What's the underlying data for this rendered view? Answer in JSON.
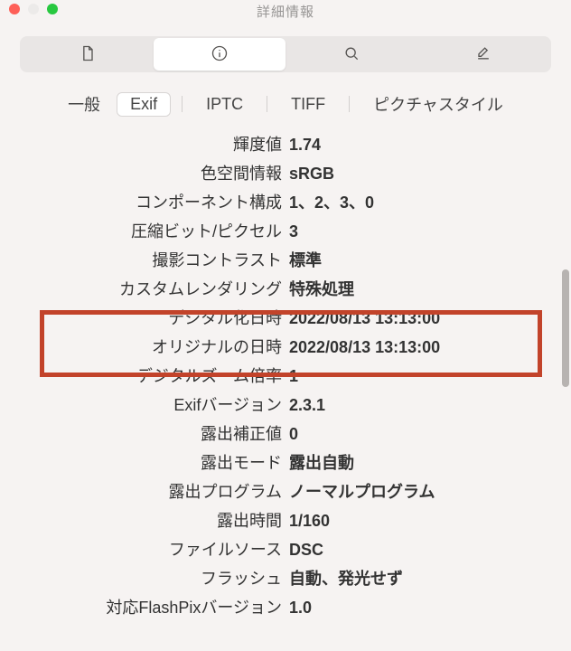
{
  "window": {
    "title": "詳細情報"
  },
  "toolbar": {
    "items": [
      {
        "name": "file-icon"
      },
      {
        "name": "info-icon",
        "selected": true
      },
      {
        "name": "search-icon"
      },
      {
        "name": "edit-icon"
      }
    ]
  },
  "tabs": {
    "items": [
      {
        "id": "general",
        "label": "一般"
      },
      {
        "id": "exif",
        "label": "Exif",
        "selected": true
      },
      {
        "id": "iptc",
        "label": "IPTC"
      },
      {
        "id": "tiff",
        "label": "TIFF"
      },
      {
        "id": "picturestyle",
        "label": "ピクチャスタイル"
      }
    ]
  },
  "exif": {
    "rows": [
      {
        "label": "輝度値",
        "value": "1.74"
      },
      {
        "label": "色空間情報",
        "value": "sRGB"
      },
      {
        "label": "コンポーネント構成",
        "value": "1、2、3、0"
      },
      {
        "label": "圧縮ビット/ピクセル",
        "value": "3"
      },
      {
        "label": "撮影コントラスト",
        "value": "標準"
      },
      {
        "label": "カスタムレンダリング",
        "value": "特殊処理"
      },
      {
        "label": "デジタル化日時",
        "value": "2022/08/13 13:13:00",
        "highlight": true
      },
      {
        "label": "オリジナルの日時",
        "value": "2022/08/13 13:13:00",
        "highlight": true
      },
      {
        "label": "デジタルズーム倍率",
        "value": "1"
      },
      {
        "label": "Exifバージョン",
        "value": "2.3.1"
      },
      {
        "label": "露出補正値",
        "value": "0"
      },
      {
        "label": "露出モード",
        "value": "露出自動"
      },
      {
        "label": "露出プログラム",
        "value": "ノーマルプログラム"
      },
      {
        "label": "露出時間",
        "value": "1/160"
      },
      {
        "label": "ファイルソース",
        "value": "DSC"
      },
      {
        "label": "フラッシュ",
        "value": "自動、発光せず"
      },
      {
        "label": "対応FlashPixバージョン",
        "value": "1.0"
      }
    ]
  }
}
